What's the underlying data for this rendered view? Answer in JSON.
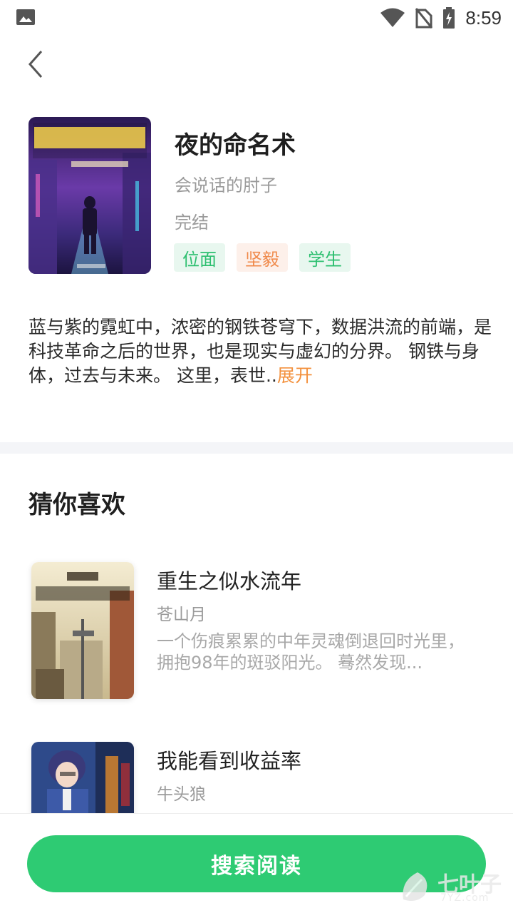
{
  "status_bar": {
    "time": "8:59"
  },
  "book": {
    "title": "夜的命名术",
    "author": "会说话的肘子",
    "status": "完结",
    "tags": [
      "位面",
      "坚毅",
      "学生"
    ],
    "description": "蓝与紫的霓虹中，浓密的钢铁苍穹下，数据洪流的前端，是科技革命之后的世界，也是现实与虚幻的分界。 钢铁与身体，过去与未来。 这里，表世..",
    "expand_label": "展开"
  },
  "recommend": {
    "section_title": "猜你喜欢",
    "items": [
      {
        "title": "重生之似水流年",
        "author": "苍山月",
        "description": "一个伤痕累累的中年灵魂倒退回时光里，拥抱98年的斑驳阳光。 蓦然发现..."
      },
      {
        "title": "我能看到收益率",
        "author": "牛头狼",
        "description": ""
      }
    ]
  },
  "bottom": {
    "search_label": "搜索阅读"
  },
  "watermark": {
    "text": "七叶子",
    "url": "7YZ.com"
  }
}
